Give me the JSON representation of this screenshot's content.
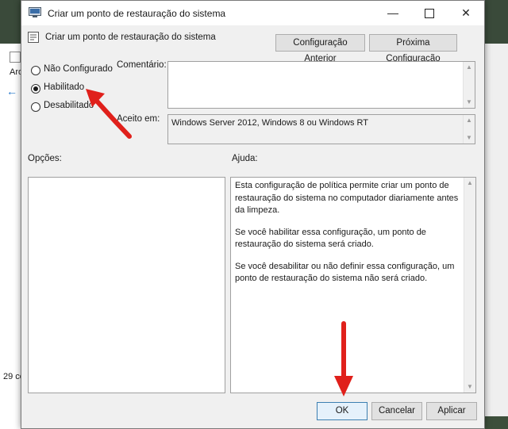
{
  "background_window": {
    "menu_fragment": "Arq",
    "status_fragment": "29 co"
  },
  "dialog": {
    "title": "Criar um ponto de restauração do sistema",
    "policy_title": "Criar um ponto de restauração do sistema",
    "prev_button": "Configuração Anterior",
    "next_button": "Próxima Configuração",
    "radios": [
      {
        "label": "Não Configurado",
        "checked": false
      },
      {
        "label": "Habilitado",
        "checked": true
      },
      {
        "label": "Desabilitado",
        "checked": false
      }
    ],
    "comment_label": "Comentário:",
    "supported_label": "Aceito em:",
    "supported_value": "Windows Server 2012, Windows 8 ou Windows RT",
    "options_label": "Opções:",
    "help_label": "Ajuda:",
    "help_paragraphs": [
      "Esta configuração de política permite criar um ponto de restauração do sistema no computador diariamente antes da limpeza.",
      "Se você habilitar essa configuração, um ponto de restauração do sistema será criado.",
      "Se você desabilitar ou não definir essa configuração, um ponto de restauração do sistema não será criado."
    ],
    "ok_button": "OK",
    "cancel_button": "Cancelar",
    "apply_button": "Aplicar"
  },
  "colors": {
    "annotation_arrow": "#e0201b",
    "ok_border": "#3c7fb1"
  }
}
